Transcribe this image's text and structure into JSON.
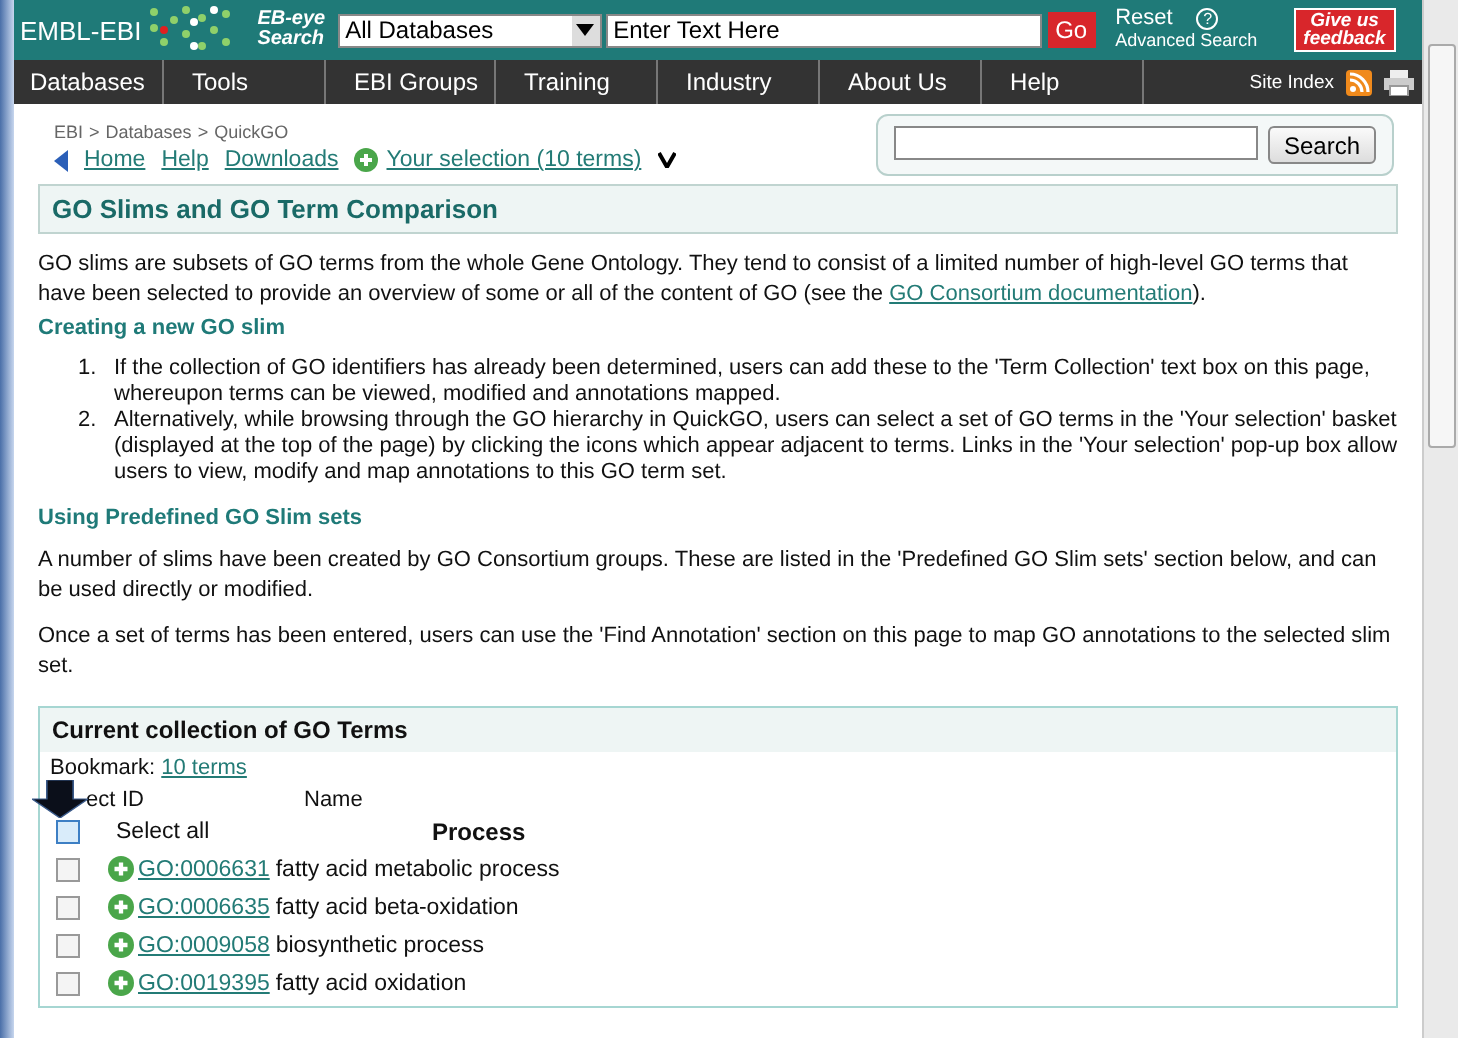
{
  "header": {
    "logo": "EMBL-EBI",
    "search_label": [
      "EB-eye",
      "Search"
    ],
    "database_select": "All Databases",
    "query_field": {
      "placeholder": "Enter Text Here"
    },
    "go_button": "Go",
    "reset": "Reset",
    "help_mark": "?",
    "advanced_search": "Advanced Search",
    "feedback": [
      "Give us",
      "feedback"
    ]
  },
  "nav": {
    "items": [
      "Databases",
      "Tools",
      "EBI Groups",
      "Training",
      "Industry",
      "About Us",
      "Help"
    ],
    "site_index": "Site Index"
  },
  "breadcrumb": {
    "items": [
      "EBI",
      "Databases",
      "QuickGO"
    ],
    "separator": ">"
  },
  "quick_links": [
    "Home",
    "Help",
    "Downloads"
  ],
  "selection_link": "Your selection (10 terms)",
  "search_button": "Search",
  "title": "GO Slims and GO Term Comparison",
  "intro": {
    "text": "GO slims are subsets of GO terms from the whole Gene Ontology. They tend to consist of a limited number of high-level GO terms that have been selected to provide an overview of some or all of the content of GO (see the ",
    "link": "GO Consortium documentation",
    "tail": ")."
  },
  "section1": {
    "heading": "Creating a new GO slim",
    "steps": [
      {
        "number": "1.",
        "text": "If the collection of GO identifiers has already been determined, users can add these to the 'Term Collection' text box on this page, whereupon terms can be viewed, modified and annotations mapped."
      },
      {
        "number": "2.",
        "text": "Alternatively, while browsing through the GO hierarchy in QuickGO, users can select a set of GO terms in the 'Your selection' basket (displayed at the top of the page) by clicking the icons which appear adjacent to terms. Links in the 'Your selection' pop-up box allow users to view, modify and map annotations to this GO term set."
      }
    ]
  },
  "section2": {
    "heading": "Using Predefined GO Slim sets",
    "paragraphs": [
      "A number of slims have been created by GO Consortium groups. These are listed in the 'Predefined GO Slim sets' section below, and can be used directly or modified.",
      "Once a set of terms has been entered, users can use the 'Find Annotation' section on this page to map GO annotations to the selected slim set."
    ]
  },
  "collection": {
    "title": "Current collection of GO Terms",
    "bookmark_label": "Bookmark:",
    "bookmark_link": "10 terms",
    "columns": [
      "ect",
      "ID",
      "Name"
    ],
    "select_all": {
      "label": "Select all",
      "checked": false
    },
    "group": "Process",
    "terms": [
      {
        "id": "GO:0006631",
        "name": "fatty acid metabolic process",
        "checked": false
      },
      {
        "id": "GO:0006635",
        "name": "fatty acid beta-oxidation",
        "checked": false
      },
      {
        "id": "GO:0009058",
        "name": "biosynthetic process",
        "checked": false
      },
      {
        "id": "GO:0019395",
        "name": "fatty acid oxidation",
        "checked": false
      }
    ]
  }
}
